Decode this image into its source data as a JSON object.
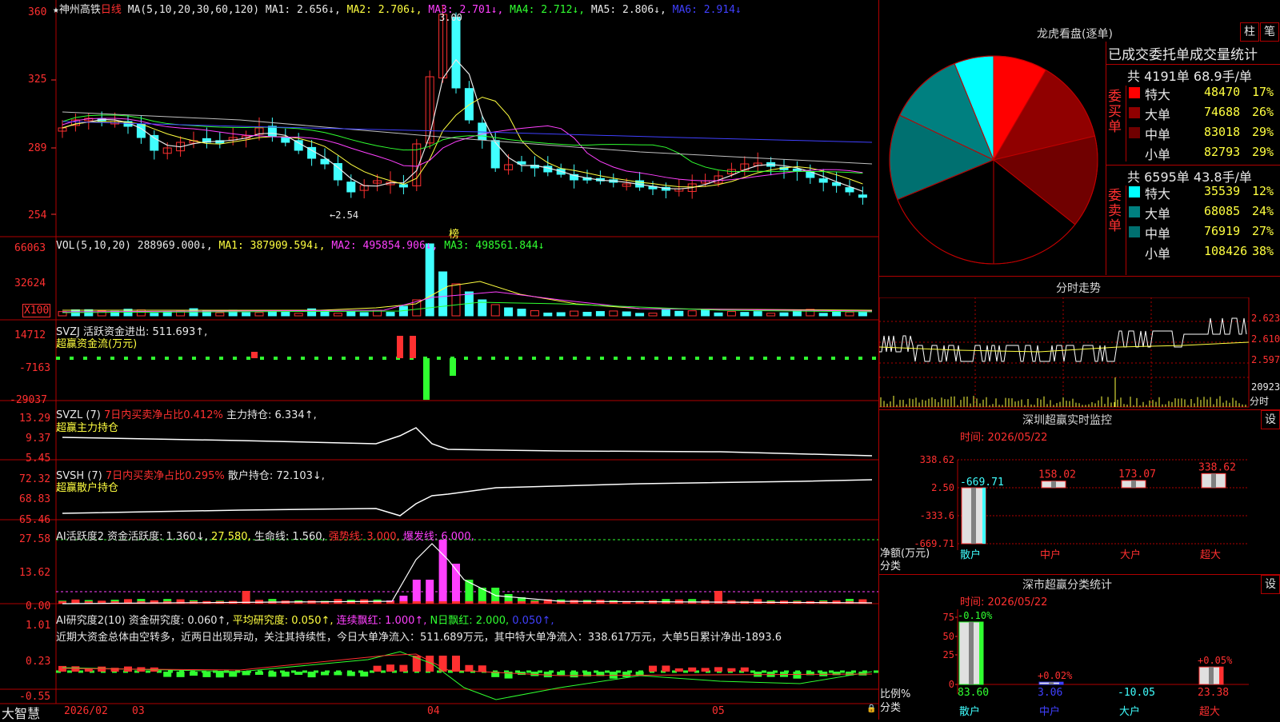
{
  "main": {
    "star": "★",
    "stock_name": "神州高铁",
    "period": "日线",
    "ma_header": "MA(5,10,20,30,60,120)",
    "ma1": "MA1: 2.656↓,",
    "ma2": "MA2: 2.706↓,",
    "ma3": "MA3: 2.701↓,",
    "ma4": "MA4: 2.712↓,",
    "ma5": "MA5: 2.806↓,",
    "ma6": "MA6: 2.914↓",
    "y_ticks": [
      "360",
      "325",
      "289",
      "254"
    ],
    "high_label": "3.00",
    "low_label": "←2.54",
    "bang": "榜",
    "colors": {
      "up": "#ff3030",
      "down": "#40ffff",
      "ma1": "#e8e8e8",
      "ma2": "#ffff40",
      "ma3": "#ff40ff",
      "ma4": "#30ff30",
      "ma5": "#c0c0c0",
      "ma6": "#4040ff"
    }
  },
  "vol": {
    "header": "VOL(5,10,20)",
    "value": "288969.000↓,",
    "ma1": "MA1: 387909.594↓,",
    "ma2": "MA2: 495854.906↓,",
    "ma3": "MA3: 498561.844↓",
    "y_ticks": [
      "66063",
      "32624"
    ],
    "unit": "X100"
  },
  "svzj": {
    "header": "SVZJ  活跃资金进出: 511.693↑,",
    "sub": "超赢资金流(万元)",
    "y_ticks": [
      "14712",
      "-7163",
      "-29037"
    ]
  },
  "svzl": {
    "header_a": "SVZL (7)",
    "header_b": "7日内买卖净占比0.412%",
    "header_c": "主力持仓: 6.334↑,",
    "sub": "超赢主力持仓",
    "y_ticks": [
      "13.29",
      "9.37",
      "5.45"
    ]
  },
  "svsh": {
    "header_a": "SVSH (7)",
    "header_b": "7日内买卖净占比0.295%",
    "header_c": "散户持仓: 72.103↓,",
    "sub": "超赢散户持仓",
    "y_ticks": [
      "72.32",
      "68.83",
      "65.46"
    ]
  },
  "ai1": {
    "a": "AI活跃度2",
    "b": "资金活跃度: 1.360↓,",
    "c": "27.580,",
    "d": "生命线: 1.560,",
    "e": "强势线: 3.000,",
    "f": "爆发线: 6.000,",
    "y_ticks": [
      "27.58",
      "13.62",
      "0.00"
    ]
  },
  "ai2": {
    "a": "AI研究度2(10)",
    "b": "资金研究度: 0.060↑,",
    "c": "平均研究度: 0.050↑,",
    "d": "连续飘红: 1.000↑,",
    "e": "N日飘红: 2.000,",
    "f": "0.050↑,",
    "comment": "近期大资金总体由空转多，近两日出现异动，关注其持续性，今日大单净流入：511.689万元，其中特大单净流入：338.617万元，大单5日累计净出-1893.6",
    "y_ticks": [
      "1.01",
      "0.23",
      "-0.55"
    ]
  },
  "bottom": {
    "brand": "大智慧",
    "dates": [
      "2026/02",
      "03",
      "04",
      "05"
    ]
  },
  "lhb": {
    "title": "龙虎看盘(逐单)",
    "btn1": "柱",
    "btn2": "笔",
    "stats_title": "已成交委托单成交量统计",
    "buy_summary": "共 4191单 68.9手/单",
    "sell_summary": "共 6595单 43.8手/单",
    "buy_label": "委买单",
    "sell_label": "委卖单",
    "buy_rows": [
      {
        "name": "特大",
        "value": "48470",
        "pct": "17%",
        "color": "#ff0000"
      },
      {
        "name": "大单",
        "value": "74688",
        "pct": "26%",
        "color": "#900000"
      },
      {
        "name": "中单",
        "value": "83018",
        "pct": "29%",
        "color": "#700000"
      },
      {
        "name": "小单",
        "value": "82793",
        "pct": "29%",
        "color": "#000000"
      }
    ],
    "sell_rows": [
      {
        "name": "特大",
        "value": "35539",
        "pct": "12%",
        "color": "#00ffff"
      },
      {
        "name": "大单",
        "value": "68085",
        "pct": "24%",
        "color": "#008080"
      },
      {
        "name": "中单",
        "value": "76919",
        "pct": "27%",
        "color": "#007070"
      },
      {
        "name": "小单",
        "value": "108426",
        "pct": "38%",
        "color": "#000000"
      }
    ]
  },
  "intraday": {
    "title": "分时走势",
    "prices": [
      "2.623",
      "2.610",
      "2.597"
    ],
    "vol": "20923",
    "unit": "分时"
  },
  "sz_monitor": {
    "title": "深圳超赢实时监控",
    "set": "设",
    "time": "时间: 2026/05/22",
    "y_ticks": [
      "338.62",
      "2.50",
      "-333.6",
      "-669.71"
    ],
    "ylabel1": "净额(万元)",
    "ylabel2": "分类",
    "bars": [
      {
        "cat": "散户",
        "value": -669.71,
        "label": "-669.71"
      },
      {
        "cat": "中户",
        "value": 158.02,
        "label": "158.02"
      },
      {
        "cat": "大户",
        "value": 173.07,
        "label": "173.07"
      },
      {
        "cat": "超大",
        "value": 338.62,
        "label": "338.62"
      }
    ]
  },
  "sz_class": {
    "title": "深市超赢分类统计",
    "set": "设",
    "time": "时间: 2026/05/22",
    "y_ticks": [
      "75",
      "50",
      "25",
      "0"
    ],
    "ylabel1": "比例%",
    "ylabel2": "分类",
    "bars": [
      {
        "cat": "散户",
        "value": 83.6,
        "label": "83.60",
        "change": "-0.10%"
      },
      {
        "cat": "中户",
        "value": 3.06,
        "label": "3.06",
        "change": "+0.02%"
      },
      {
        "cat": "大户",
        "value": -10.05,
        "label": "-10.05",
        "change": ""
      },
      {
        "cat": "超大",
        "value": 23.38,
        "label": "23.38",
        "change": "+0.05%"
      }
    ]
  }
}
